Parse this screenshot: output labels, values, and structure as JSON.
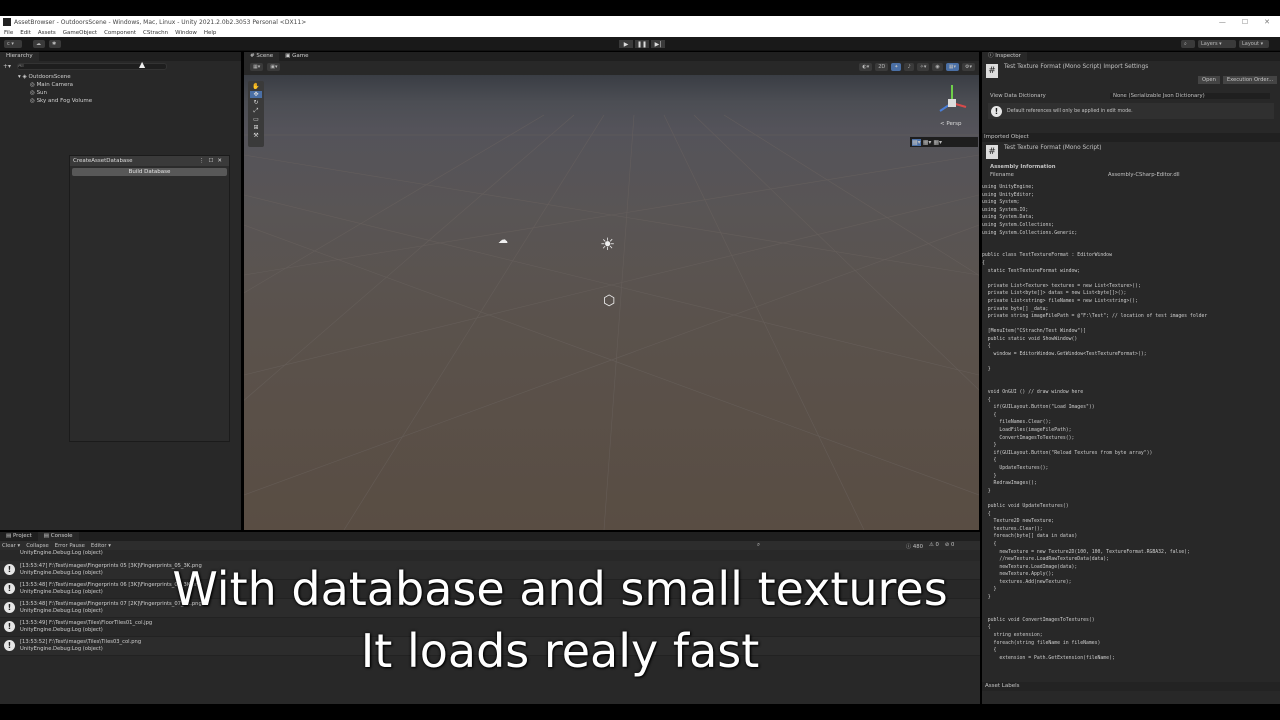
{
  "window": {
    "title": "AssetBrowser - OutdoorsScene - Windows, Mac, Linux - Unity 2021.2.0b2.3053 Personal <DX11>",
    "controls": [
      "—",
      "☐",
      "✕"
    ]
  },
  "menu": [
    "File",
    "Edit",
    "Assets",
    "GameObject",
    "Component",
    "CStrachn",
    "Window",
    "Help"
  ],
  "toolbar": {
    "account": "c ▾",
    "layers": "Layers",
    "layout": "Layout",
    "play": "▶",
    "pause": "❚❚",
    "step": "▶|"
  },
  "hierarchy": {
    "tab": "Hierarchy",
    "search_placeholder": "All",
    "scene": "OutdoorsScene",
    "items": [
      "Main Camera",
      "Sun",
      "Sky and Fog Volume"
    ]
  },
  "create_db_window": {
    "title": "CreateAssetDatabase",
    "button": "Build Database"
  },
  "scene_view": {
    "tabs": [
      "Scene",
      "Game"
    ],
    "mode_2d": "2D",
    "persp": "< Persp"
  },
  "inspector": {
    "tab": "Inspector",
    "header_title": "Test Texture Format (Mono Script) Import Settings",
    "open_btn": "Open",
    "exec_order_btn": "Execution Order...",
    "view_data_dict_label": "View Data Dictionary",
    "view_data_dict_value": "None (Serializable Json Dictionary)",
    "info": "Default references will only be applied in edit mode.",
    "imported_object": "Imported Object",
    "object_title": "Test Texture Format (Mono Script)",
    "assembly_info": "Assembly Information",
    "filename_label": "Filename",
    "filename_value": "Assembly-CSharp-Editor.dll",
    "asset_labels": "Asset Labels",
    "code": "using UnityEngine;\nusing UnityEditor;\nusing System;\nusing System.IO;\nusing System.Data;\nusing System.Collections;\nusing System.Collections.Generic;\n\n\npublic class TestTextureFormat : EditorWindow\n{\n  static TestTextureFormat window;\n\n  private List<Texture> textures = new List<Texture>();\n  private List<byte[]> datas = new List<byte[]>();\n  private List<string> fileNames = new List<string>();\n  private byte[] _data;\n  private string imageFilePath = @\"F:\\Test\"; // location of test images folder\n\n  [MenuItem(\"CStrachn/Test Window\")]\n  public static void ShowWindow()\n  {\n    window = EditorWindow.GetWindow<TestTextureFormat>();\n\n  }\n\n\n  void OnGUI () // draw window here\n  {\n    if(GUILayout.Button(\"Load Images\"))\n    {\n      fileNames.Clear();\n      LoadFiles(imageFilePath);\n      ConvertImagesToTextures();\n    }\n    if(GUILayout.Button(\"Reload Textures from byte array\"))\n    {\n      UpdateTextures();\n    }\n    RedrawImages();\n  }\n\n  public void UpdateTextures()\n  {\n    Texture2D newTexture;\n    textures.Clear();\n    foreach(byte[] data in datas)\n    {\n      newTexture = new Texture2D(100, 100, TextureFormat.RGBA32, false);\n      //newTexture.LoadRawTextureData(data);\n      newTexture.LoadImage(data);\n      newTexture.Apply();\n      textures.Add(newTexture);\n    }\n  }\n\n\n  public void ConvertImagesToTextures()\n  {\n    string extension;\n    foreach(string fileName in fileNames)\n    {\n      extension = Path.GetExtension(fileName);"
  },
  "console": {
    "tabs": [
      "Project",
      "Console"
    ],
    "buttons": [
      "Clear ▾",
      "Collapse",
      "Error Pause",
      "Editor ▾"
    ],
    "counts": [
      "480",
      "0",
      "0"
    ],
    "top_partial": "UnityEngine.Debug:Log (object)",
    "logs": [
      {
        "line1": "[13:53:47] F:\\Test\\images\\Fingerprints 05 [3K]\\Fingerprints_05_3K.png",
        "line2": "UnityEngine.Debug:Log (object)"
      },
      {
        "line1": "[13:53:48] F:\\Test\\images\\Fingerprints 06 [3K]\\Fingerprints_06_3K.png",
        "line2": "UnityEngine.Debug:Log (object)"
      },
      {
        "line1": "[13:53:48] F:\\Test\\images\\Fingerprints 07 [2K]\\Fingerprints_07_2K.png",
        "line2": "UnityEngine.Debug:Log (object)"
      },
      {
        "line1": "[13:53:49] F:\\Test\\images\\Tiles\\FloorTiles01_col.jpg",
        "line2": "UnityEngine.Debug:Log (object)"
      },
      {
        "line1": "[13:53:52] F:\\Test\\images\\Tiles\\Tiles03_col.png",
        "line2": "UnityEngine.Debug:Log (object)"
      }
    ]
  },
  "subtitles": {
    "line1": "With database and small textures",
    "line2": "It loads realy fast"
  }
}
